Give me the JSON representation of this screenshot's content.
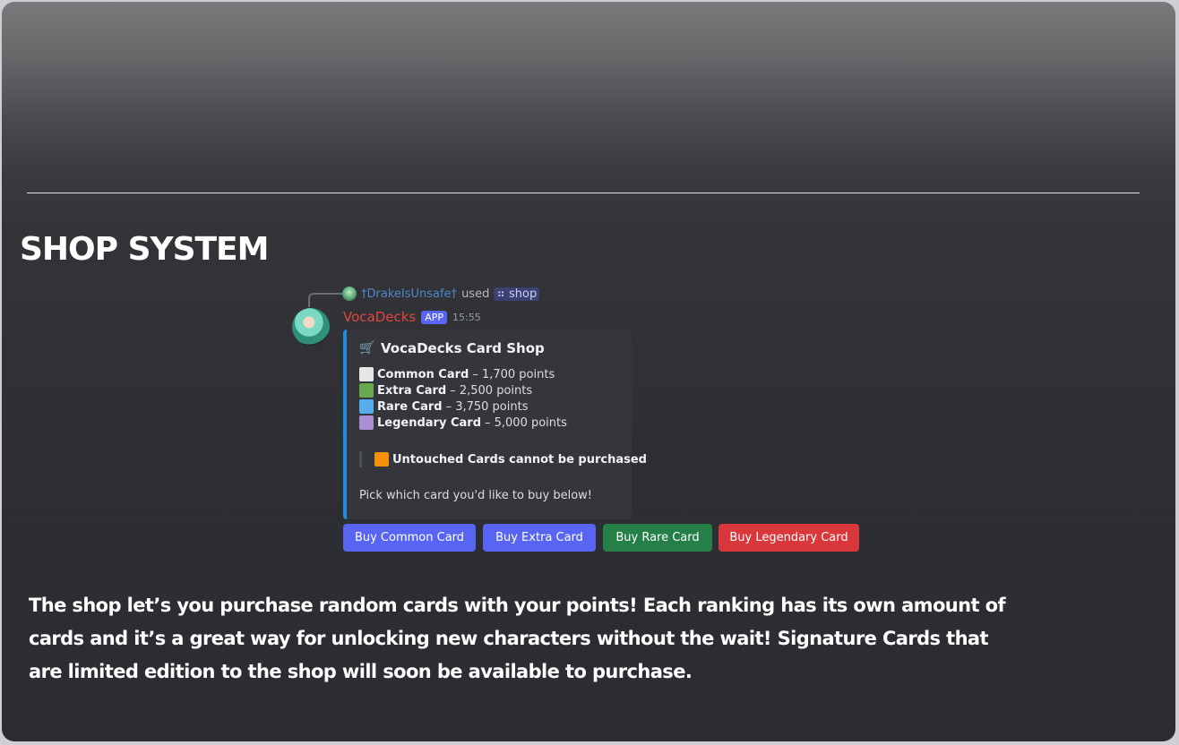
{
  "page": {
    "title": "SHOP SYSTEM"
  },
  "message": {
    "reply_user": "†DrakeIsUnsafe†",
    "reply_used": "used",
    "command": "shop",
    "bot_name": "VocaDecks",
    "app_badge": "APP",
    "timestamp": "15:55",
    "embed": {
      "accent_color": "#1e8fe0",
      "title_icon": "shopping-cart-icon",
      "title": "VocaDecks Card Shop",
      "tiers": [
        {
          "name": "Common Card",
          "price": "– 1,700 points",
          "color": "#e6e6e6"
        },
        {
          "name": "Extra Card",
          "price": "– 2,500 points",
          "color": "#6aa84f"
        },
        {
          "name": "Rare Card",
          "price": "– 3,750 points",
          "color": "#55acee"
        },
        {
          "name": "Legendary Card",
          "price": "– 5,000 points",
          "color": "#aa8ed6"
        }
      ],
      "notice": "Untouched Cards cannot be purchased",
      "notice_color": "#f4900c",
      "footer_text": "Pick which card you'd like to buy below!"
    },
    "buttons": [
      {
        "label": "Buy Common Card",
        "style": "blurple"
      },
      {
        "label": "Buy Extra Card",
        "style": "blurple"
      },
      {
        "label": "Buy Rare Card",
        "style": "green"
      },
      {
        "label": "Buy Legendary Card",
        "style": "red"
      }
    ]
  },
  "description": "The shop let’s you purchase random cards with your points! Each ranking has its own amount of cards and it’s a great way for unlocking new characters without the wait! Signature Cards that are limited edition to the shop will soon be available to purchase."
}
